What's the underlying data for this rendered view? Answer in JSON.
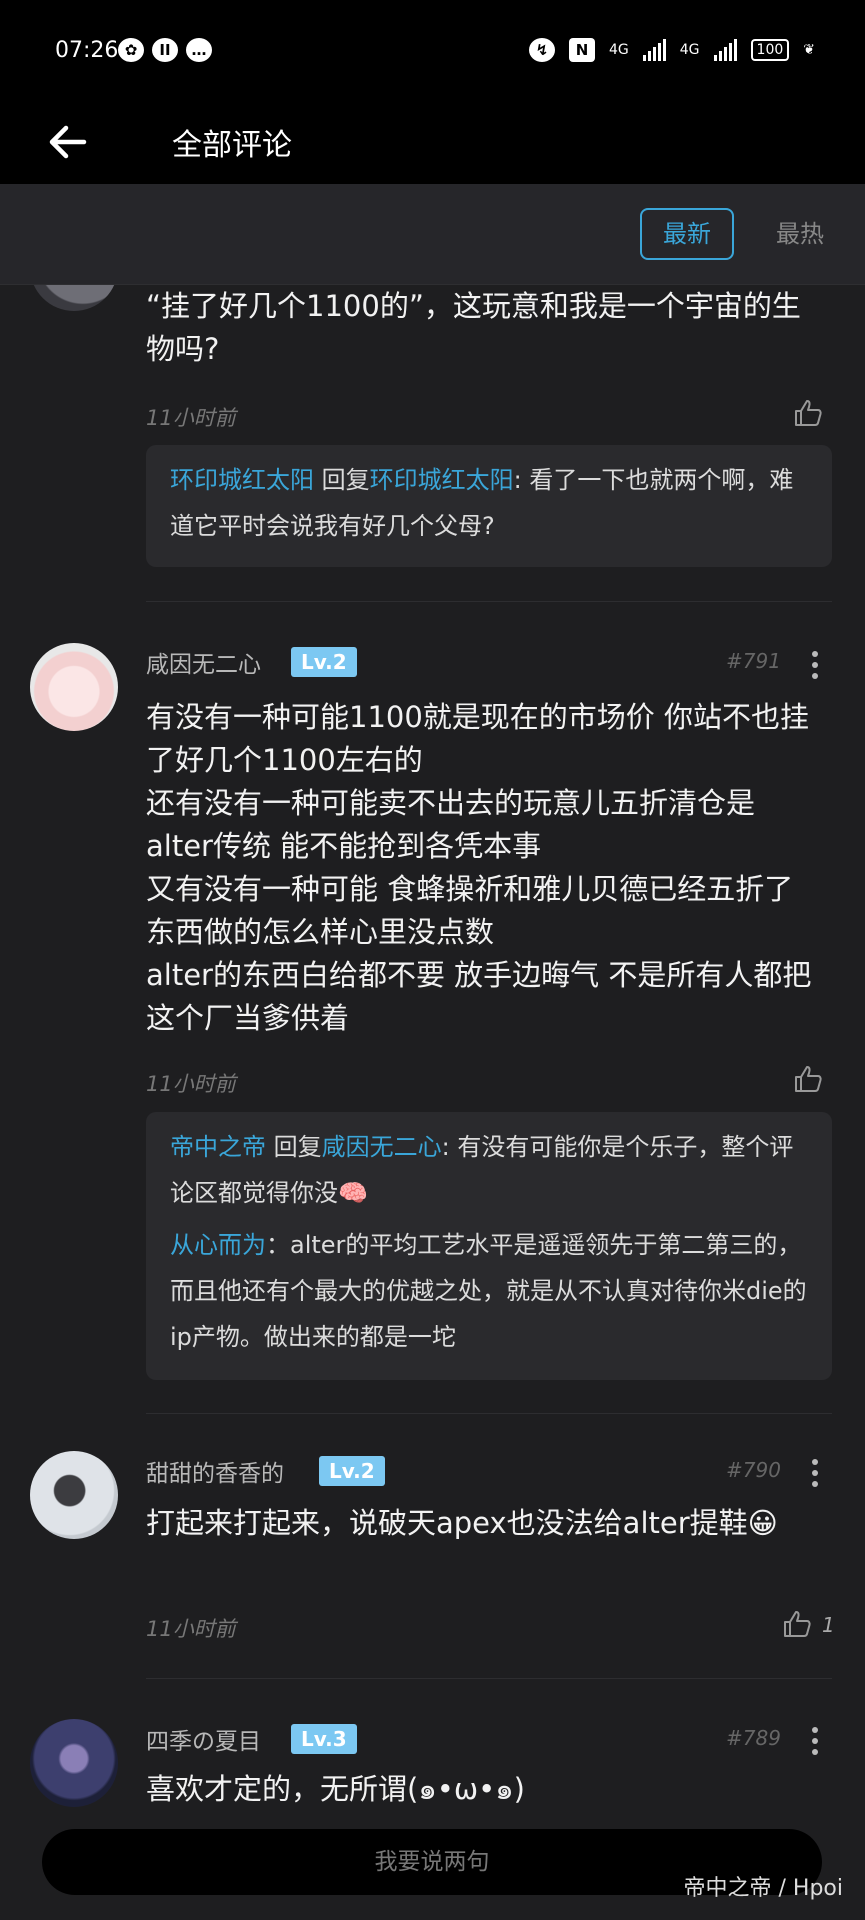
{
  "status_bar": {
    "time": "07:26",
    "network_1": "4G",
    "network_2": "4G",
    "battery": "100"
  },
  "header": {
    "title": "全部评论"
  },
  "sort_tabs": {
    "latest": "最新",
    "hot": "最热"
  },
  "comments": [
    {
      "body": "“挂了好几个1100的”，这玩意和我是一个宇宙的生物吗?",
      "time": "11小时前",
      "reply_block": [
        {
          "user": "环印城红太阳",
          "reply_word": "回复",
          "target": "环印城红太阳",
          "text": ": 看了一下也就两个啊，难道它平时会说我有好几个父母?"
        }
      ]
    },
    {
      "username": "咸因无二心",
      "level": "Lv.2",
      "floor": "#791",
      "body_lines": [
        "有没有一种可能1100就是现在的市场价 你站不也挂了好几个1100左右的",
        "还有没有一种可能卖不出去的玩意儿五折清仓是alter传统 能不能抢到各凭本事",
        "又有没有一种可能 食蜂操祈和雅儿贝德已经五折了 东西做的怎么样心里没点数",
        "alter的东西白给都不要 放手边晦气 不是所有人都把这个厂当爹供着"
      ],
      "time": "11小时前",
      "reply_block": [
        {
          "user": "帝中之帝",
          "reply_word": "回复",
          "target": "咸因无二心",
          "text": ": 有没有可能你是个乐子，整个评论区都觉得你没🧠"
        },
        {
          "user": "从心而为",
          "text": "：alter的平均工艺水平是遥遥领先于第二第三的，而且他还有个最大的优越之处，就是从不认真对待你米die的ip产物。做出来的都是一坨"
        }
      ]
    },
    {
      "username": "甜甜的香香的",
      "level": "Lv.2",
      "floor": "#790",
      "body": "打起来打起来，说破天apex也没法给alter提鞋😀",
      "time": "11小时前",
      "likes": "1"
    },
    {
      "username": "四季の夏目",
      "level": "Lv.3",
      "floor": "#789",
      "body": "喜欢才定的，无所谓(๑•ω•๑)"
    }
  ],
  "input": {
    "placeholder": "我要说两句"
  },
  "watermark": "帝中之帝 / Hpoi",
  "colors": {
    "accent": "#3aa6d9",
    "level_badge": "#7cc8f2",
    "background": "#1e1e20"
  }
}
